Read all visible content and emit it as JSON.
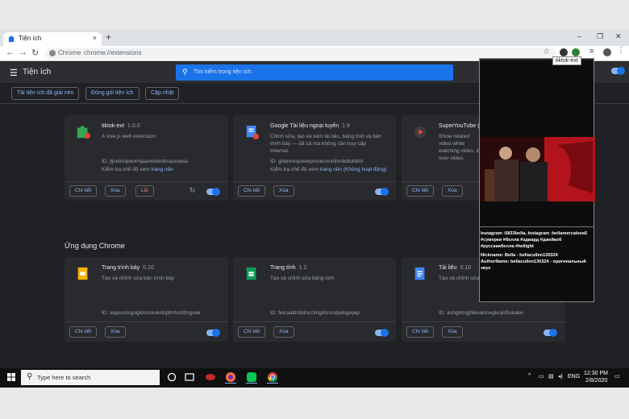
{
  "browser": {
    "tab_title": "Tiện ích",
    "tab_close": "×",
    "new_tab": "+",
    "window_controls": [
      "–",
      "❐",
      "✕"
    ],
    "omnibox_site": "Chrome",
    "omnibox_url": "chrome://extensions",
    "tooltip": "tiktok-ext"
  },
  "header": {
    "title": "Tiện ích",
    "search_placeholder": "Tìm kiếm trong tiện ích"
  },
  "toolbar": {
    "load_unpacked": "Tải tiện ích đã giải nén",
    "pack": "Đóng gói tiện ích",
    "update": "Cập nhật"
  },
  "extensions": [
    {
      "name": "tiktok-ext",
      "version": "1.0.0",
      "desc": "A Vue.js web extension",
      "id": "ID: jljcelnclpenlmjaanenbolknaoooeia",
      "inspect": "Kiểm tra chế độ xem",
      "inspect_link": "trang nền",
      "inspect_extra": "",
      "details": "Chi tiết",
      "remove": "Xóa",
      "errors": "Lỗi"
    },
    {
      "name": "Google Tài liệu ngoại tuyến",
      "version": "1.9",
      "desc": "Chỉnh sửa, tạo và xem tài liệu, bảng tính và bản trình bày — tất cả mà không cần truy cập Internet.",
      "id": "ID: ghbmnnjooekpmoecnnnilnnbdlolhkhi",
      "inspect": "Kiểm tra chế độ xem",
      "inspect_link": "trang nền",
      "inspect_extra": "(Không hoạt động)",
      "details": "Chi tiết",
      "remove": "Xóa"
    },
    {
      "name": "SuperYouTube (E",
      "version": "",
      "desc": "Show related video while watching video, it over video.",
      "details": "Chi tiết",
      "remove": "Xóa"
    }
  ],
  "apps_section_title": "Ứng dụng Chrome",
  "apps": [
    {
      "name": "Trang trình bày",
      "version": "0.10",
      "desc": "Tạo và chỉnh sửa bản trình bày",
      "id": "ID: aapocclcgogkmnckokdopfmhonfmgoek",
      "details": "Chi tiết",
      "remove": "Xóa"
    },
    {
      "name": "Trang tính",
      "version": "1.2",
      "desc": "Tạo và chỉnh sửa bảng tính",
      "id": "ID: felcaaldnbdncclmgdcncolpebgiejap",
      "details": "Chi tiết",
      "remove": "Xóa"
    },
    {
      "name": "Tài liệu",
      "version": "0.10",
      "desc": "Tạo và chỉnh sửa tài liệu",
      "id": "ID: aohghmighlieiainnegkcijnfilokake",
      "details": "Chi tiết",
      "remove": "Xóa"
    }
  ],
  "popup": {
    "caption": "Instagram :5833bella, Instagram :bellamercalova5 #сумерки #белла #эдвард #джейкоб #русскаябелла #twilight",
    "nickname": "Nickname: Bella - bellacullen130324",
    "author": "AuthorName: bellacullen130324 - оригинальный звук"
  },
  "taskbar": {
    "search_text": "Type here to search",
    "language": "ENG",
    "time": "12:30 PM",
    "date": "2/8/2020"
  },
  "colors": {
    "accent": "#8ab4f8",
    "search_bar": "#1a73e8",
    "background": "#202124",
    "card": "#292a2d",
    "error": "#f28b82"
  }
}
